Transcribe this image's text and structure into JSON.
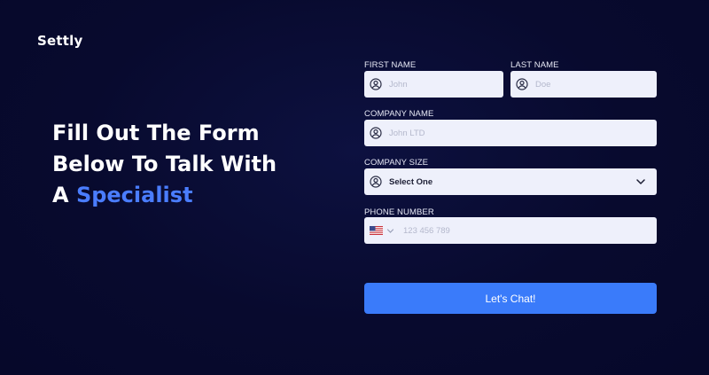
{
  "brand": "Settly",
  "headline": {
    "line1": "Fill Out The Form",
    "line2": "Below To Talk With",
    "line3_prefix": "A ",
    "line3_accent": "Specialist"
  },
  "form": {
    "first_name": {
      "label": "FIRST NAME",
      "placeholder": "John"
    },
    "last_name": {
      "label": "LAST NAME",
      "placeholder": "Doe"
    },
    "company_name": {
      "label": "COMPANY NAME",
      "placeholder": "John LTD"
    },
    "company_size": {
      "label": "COMPANY SIZE",
      "value": "Select One"
    },
    "phone": {
      "label": "PHONE NUMBER",
      "placeholder": "123 456 789",
      "country_icon": "us-flag-icon"
    },
    "submit_label": "Let's Chat!"
  },
  "colors": {
    "accent": "#4a7dff",
    "button": "#3a7bfa",
    "background": "#080a2e",
    "field": "#eef0fb"
  }
}
